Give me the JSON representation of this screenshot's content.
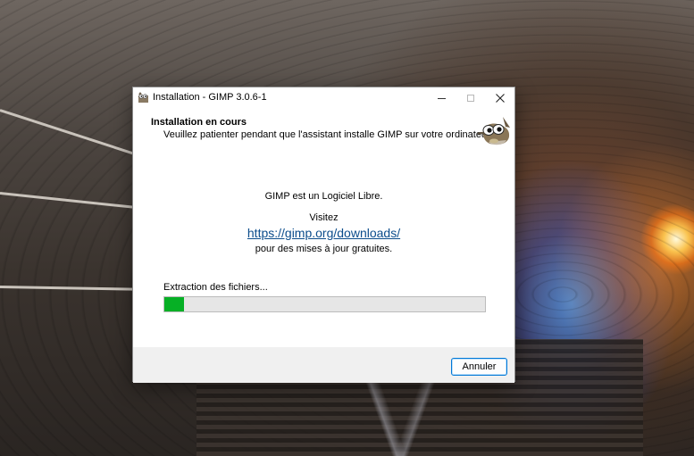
{
  "window": {
    "title": "Installation - GIMP 3.0.6-1"
  },
  "header": {
    "title": "Installation en cours",
    "subtitle": "Veuillez patienter pendant que l'assistant installe GIMP sur votre ordinateur."
  },
  "content": {
    "free_software": "GIMP est un Logiciel Libre.",
    "visit": "Visitez",
    "link": "https://gimp.org/downloads/",
    "updates": "pour des mises à jour gratuites."
  },
  "progress": {
    "label": "Extraction des fichiers...",
    "fraction": 0.06,
    "color": "#06b025"
  },
  "footer": {
    "cancel_label": "Annuler"
  },
  "icons": {
    "app": "gimp-icon",
    "header_logo": "wilber-mascot-icon",
    "minimize": "minimize-icon",
    "maximize": "maximize-icon",
    "close": "close-icon"
  }
}
